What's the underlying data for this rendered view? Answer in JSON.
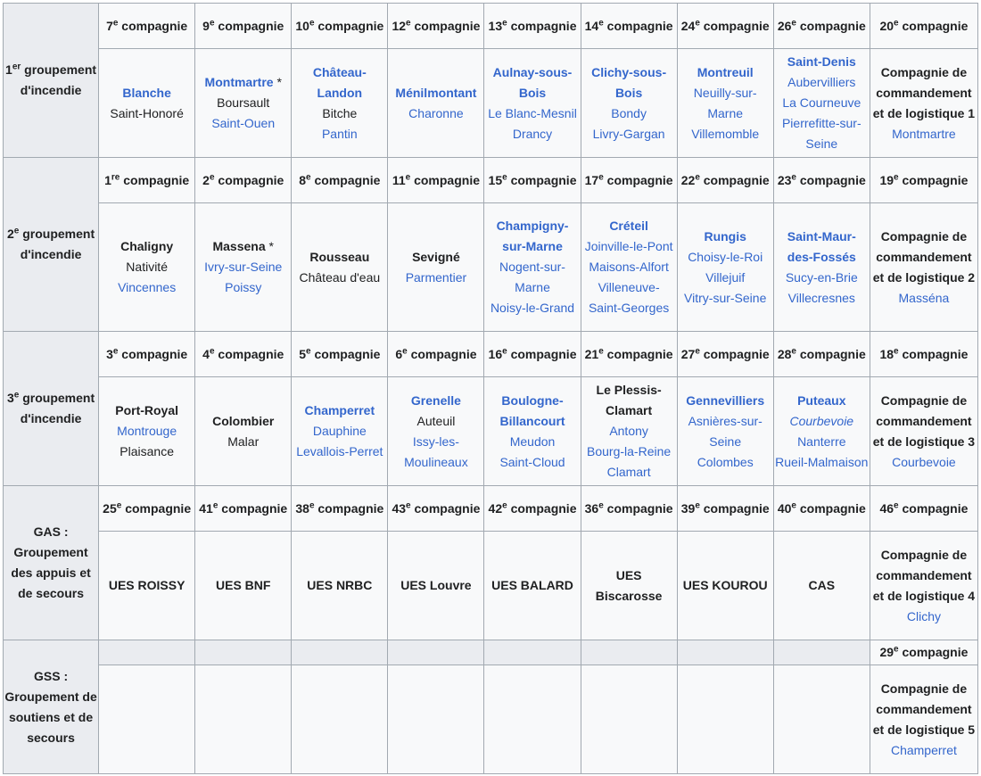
{
  "groups": [
    {
      "label": "1er groupement d'incendie",
      "label_parts": [
        "1",
        "er",
        " groupement d'incendie"
      ],
      "headers": [
        {
          "num": "7",
          "sup": "e",
          "suffix": " compagnie"
        },
        {
          "num": "9",
          "sup": "e",
          "suffix": " compagnie"
        },
        {
          "num": "10",
          "sup": "e",
          "suffix": " compagnie"
        },
        {
          "num": "12",
          "sup": "e",
          "suffix": " compagnie"
        },
        {
          "num": "13",
          "sup": "e",
          "suffix": " compagnie"
        },
        {
          "num": "14",
          "sup": "e",
          "suffix": " compagnie"
        },
        {
          "num": "24",
          "sup": "e",
          "suffix": " compagnie"
        },
        {
          "num": "26",
          "sup": "e",
          "suffix": " compagnie"
        },
        {
          "num": "20",
          "sup": "e",
          "suffix": " compagnie"
        }
      ],
      "cells": [
        [
          {
            "t": "Blanche",
            "s": "bl"
          },
          {
            "t": "Saint-Honoré",
            "s": "n"
          }
        ],
        [
          {
            "t": "Montmartre",
            "s": "bl",
            "mark": " *"
          },
          {
            "t": "Boursault",
            "s": "n"
          },
          {
            "t": "Saint-Ouen",
            "s": "l"
          }
        ],
        [
          {
            "t": "Château-Landon",
            "s": "bl"
          },
          {
            "t": "Bitche",
            "s": "n"
          },
          {
            "t": "Pantin",
            "s": "l"
          }
        ],
        [
          {
            "t": "Ménilmontant",
            "s": "bl"
          },
          {
            "t": "Charonne",
            "s": "l"
          }
        ],
        [
          {
            "t": "Aulnay-sous-Bois",
            "s": "bl"
          },
          {
            "t": "Le Blanc-Mesnil",
            "s": "l"
          },
          {
            "t": "Drancy",
            "s": "l"
          }
        ],
        [
          {
            "t": "Clichy-sous-Bois",
            "s": "bl"
          },
          {
            "t": "Bondy",
            "s": "l"
          },
          {
            "t": "Livry-Gargan",
            "s": "l"
          }
        ],
        [
          {
            "t": "Montreuil",
            "s": "bl"
          },
          {
            "t": "Neuilly-sur-Marne",
            "s": "l"
          },
          {
            "t": "Villemomble",
            "s": "l"
          }
        ],
        [
          {
            "t": "Saint-Denis",
            "s": "bl"
          },
          {
            "t": "Aubervilliers",
            "s": "l"
          },
          {
            "t": "La Courneuve",
            "s": "l"
          },
          {
            "t": "Pierrefitte-sur-Seine",
            "s": "l"
          }
        ],
        [
          {
            "t": "Compagnie de commandement et de logistique 1",
            "s": "k"
          },
          {
            "t": "Montmartre",
            "s": "l"
          }
        ]
      ]
    },
    {
      "label": "2e groupement d'incendie",
      "label_parts": [
        "2",
        "e",
        " groupement d'incendie"
      ],
      "headers": [
        {
          "num": "1",
          "sup": "re",
          "suffix": " compagnie"
        },
        {
          "num": "2",
          "sup": "e",
          "suffix": " compagnie"
        },
        {
          "num": "8",
          "sup": "e",
          "suffix": " compagnie"
        },
        {
          "num": "11",
          "sup": "e",
          "suffix": " compagnie"
        },
        {
          "num": "15",
          "sup": "e",
          "suffix": " compagnie"
        },
        {
          "num": "17",
          "sup": "e",
          "suffix": " compagnie"
        },
        {
          "num": "22",
          "sup": "e",
          "suffix": " compagnie"
        },
        {
          "num": "23",
          "sup": "e",
          "suffix": " compagnie"
        },
        {
          "num": "19",
          "sup": "e",
          "suffix": " compagnie"
        }
      ],
      "cells": [
        [
          {
            "t": "Chaligny",
            "s": "k"
          },
          {
            "t": "Nativité",
            "s": "n"
          },
          {
            "t": "Vincennes",
            "s": "l"
          }
        ],
        [
          {
            "t": "Massena",
            "s": "k",
            "mark": " *"
          },
          {
            "t": "Ivry-sur-Seine",
            "s": "l"
          },
          {
            "t": "Poissy",
            "s": "l"
          }
        ],
        [
          {
            "t": "Rousseau",
            "s": "k"
          },
          {
            "t": "Château d'eau",
            "s": "n"
          }
        ],
        [
          {
            "t": "Sevigné",
            "s": "k"
          },
          {
            "t": "Parmentier",
            "s": "l"
          }
        ],
        [
          {
            "t": "Champigny-sur-Marne",
            "s": "bl"
          },
          {
            "t": "Nogent-sur-Marne",
            "s": "l"
          },
          {
            "t": "Noisy-le-Grand",
            "s": "l"
          }
        ],
        [
          {
            "t": "Créteil",
            "s": "bl"
          },
          {
            "t": "Joinville-le-Pont",
            "s": "l"
          },
          {
            "t": "Maisons-Alfort",
            "s": "l"
          },
          {
            "t": "Villeneuve-Saint-Georges",
            "s": "l"
          }
        ],
        [
          {
            "t": "Rungis",
            "s": "bl"
          },
          {
            "t": "Choisy-le-Roi",
            "s": "l"
          },
          {
            "t": "Villejuif",
            "s": "l"
          },
          {
            "t": "Vitry-sur-Seine",
            "s": "l"
          }
        ],
        [
          {
            "t": "Saint-Maur-des-Fossés",
            "s": "bl"
          },
          {
            "t": "Sucy-en-Brie",
            "s": "l"
          },
          {
            "t": "Villecresnes",
            "s": "l"
          }
        ],
        [
          {
            "t": "Compagnie de commandement et de logistique 2",
            "s": "k"
          },
          {
            "t": "Masséna",
            "s": "l"
          }
        ]
      ]
    },
    {
      "label": "3e groupement d'incendie",
      "label_parts": [
        "3",
        "e",
        " groupement d'incendie"
      ],
      "headers": [
        {
          "num": "3",
          "sup": "e",
          "suffix": " compagnie"
        },
        {
          "num": "4",
          "sup": "e",
          "suffix": " compagnie"
        },
        {
          "num": "5",
          "sup": "e",
          "suffix": " compagnie"
        },
        {
          "num": "6",
          "sup": "e",
          "suffix": " compagnie"
        },
        {
          "num": "16",
          "sup": "e",
          "suffix": " compagnie"
        },
        {
          "num": "21",
          "sup": "e",
          "suffix": " compagnie"
        },
        {
          "num": "27",
          "sup": "e",
          "suffix": " compagnie"
        },
        {
          "num": "28",
          "sup": "e",
          "suffix": " compagnie"
        },
        {
          "num": "18",
          "sup": "e",
          "suffix": " compagnie"
        }
      ],
      "cells": [
        [
          {
            "t": "Port-Royal",
            "s": "k"
          },
          {
            "t": "Montrouge",
            "s": "l"
          },
          {
            "t": "Plaisance",
            "s": "n"
          }
        ],
        [
          {
            "t": "Colombier",
            "s": "k"
          },
          {
            "t": "Malar",
            "s": "n"
          }
        ],
        [
          {
            "t": "Champerret",
            "s": "bl"
          },
          {
            "t": "Dauphine",
            "s": "l"
          },
          {
            "t": "Levallois-Perret",
            "s": "l"
          }
        ],
        [
          {
            "t": "Grenelle",
            "s": "bl"
          },
          {
            "t": "Auteuil",
            "s": "n"
          },
          {
            "t": "Issy-les-Moulineaux",
            "s": "l"
          }
        ],
        [
          {
            "t": "Boulogne-Billancourt",
            "s": "bl"
          },
          {
            "t": "Meudon",
            "s": "l"
          },
          {
            "t": "Saint-Cloud",
            "s": "l"
          }
        ],
        [
          {
            "t": "Le Plessis-Clamart",
            "s": "k"
          },
          {
            "t": "Antony",
            "s": "l"
          },
          {
            "t": "Bourg-la-Reine",
            "s": "l"
          },
          {
            "t": "Clamart",
            "s": "l"
          }
        ],
        [
          {
            "t": "Gennevilliers",
            "s": "bl"
          },
          {
            "t": "Asnières-sur-Seine",
            "s": "l"
          },
          {
            "t": "Colombes",
            "s": "l"
          }
        ],
        [
          {
            "t": "Puteaux",
            "s": "bl"
          },
          {
            "t": "Courbevoie",
            "s": "i"
          },
          {
            "t": "Nanterre",
            "s": "l"
          },
          {
            "t": "Rueil-Malmaison",
            "s": "l"
          }
        ],
        [
          {
            "t": "Compagnie de commandement et de logistique 3",
            "s": "k"
          },
          {
            "t": "Courbevoie",
            "s": "l"
          }
        ]
      ]
    },
    {
      "label": "GAS : Groupement des appuis et de secours",
      "label_parts": [
        "",
        "",
        "GAS : Groupement des appuis et de secours"
      ],
      "headers": [
        {
          "num": "25",
          "sup": "e",
          "suffix": " compagnie"
        },
        {
          "num": "41",
          "sup": "e",
          "suffix": " compagnie"
        },
        {
          "num": "38",
          "sup": "e",
          "suffix": " compagnie"
        },
        {
          "num": "43",
          "sup": "e",
          "suffix": " compagnie"
        },
        {
          "num": "42",
          "sup": "e",
          "suffix": " compagnie"
        },
        {
          "num": "36",
          "sup": "e",
          "suffix": " compagnie"
        },
        {
          "num": "39",
          "sup": "e",
          "suffix": " compagnie"
        },
        {
          "num": "40",
          "sup": "e",
          "suffix": " compagnie"
        },
        {
          "num": "46",
          "sup": "e",
          "suffix": " compagnie"
        }
      ],
      "cells": [
        [
          {
            "t": "UES ROISSY",
            "s": "k"
          }
        ],
        [
          {
            "t": "UES BNF",
            "s": "k"
          }
        ],
        [
          {
            "t": "UES NRBC",
            "s": "k"
          }
        ],
        [
          {
            "t": "UES Louvre",
            "s": "k"
          }
        ],
        [
          {
            "t": "UES BALARD",
            "s": "k"
          }
        ],
        [
          {
            "t": "UES Biscarosse",
            "s": "k"
          }
        ],
        [
          {
            "t": "UES KOUROU",
            "s": "k"
          }
        ],
        [
          {
            "t": "CAS",
            "s": "k"
          }
        ],
        [
          {
            "t": "Compagnie de commandement et de logistique 4",
            "s": "k"
          },
          {
            "t": "Clichy",
            "s": "l"
          }
        ]
      ]
    },
    {
      "label": "GSS : Groupement de soutiens et de secours",
      "label_parts": [
        "",
        "",
        "GSS : Groupement de soutiens et de secours"
      ],
      "headers": [
        null,
        null,
        null,
        null,
        null,
        null,
        null,
        null,
        {
          "num": "29",
          "sup": "e",
          "suffix": " compagnie"
        }
      ],
      "cells": [
        [],
        [],
        [],
        [],
        [],
        [],
        [],
        [],
        [
          {
            "t": "Compagnie de commandement et de logistique 5",
            "s": "k"
          },
          {
            "t": "Champerret",
            "s": "l"
          }
        ]
      ]
    }
  ],
  "colors": {
    "border": "#a2a9b1",
    "header_bg": "#eaecf0",
    "cell_bg": "#f8f9fa",
    "link": "#3366cc",
    "text": "#202122"
  }
}
